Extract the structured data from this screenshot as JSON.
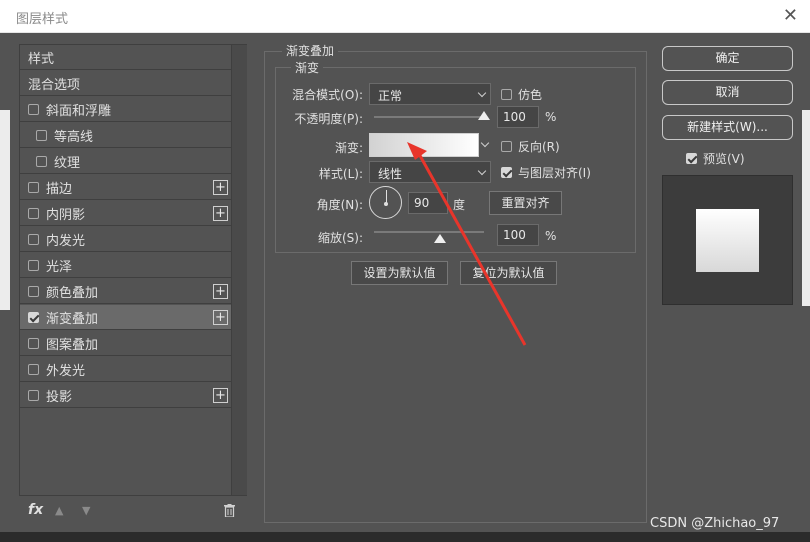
{
  "window": {
    "title": "图层样式",
    "close_symbol": "✕"
  },
  "style_list": {
    "items": [
      {
        "label": "样式",
        "checkbox": false,
        "checked": false,
        "plus": false,
        "indent": false,
        "selected": false
      },
      {
        "label": "混合选项",
        "checkbox": false,
        "checked": false,
        "plus": false,
        "indent": false,
        "selected": false
      },
      {
        "label": "斜面和浮雕",
        "checkbox": true,
        "checked": false,
        "plus": false,
        "indent": false,
        "selected": false
      },
      {
        "label": "等高线",
        "checkbox": true,
        "checked": false,
        "plus": false,
        "indent": true,
        "selected": false
      },
      {
        "label": "纹理",
        "checkbox": true,
        "checked": false,
        "plus": false,
        "indent": true,
        "selected": false
      },
      {
        "label": "描边",
        "checkbox": true,
        "checked": false,
        "plus": true,
        "indent": false,
        "selected": false
      },
      {
        "label": "内阴影",
        "checkbox": true,
        "checked": false,
        "plus": true,
        "indent": false,
        "selected": false
      },
      {
        "label": "内发光",
        "checkbox": true,
        "checked": false,
        "plus": false,
        "indent": false,
        "selected": false
      },
      {
        "label": "光泽",
        "checkbox": true,
        "checked": false,
        "plus": false,
        "indent": false,
        "selected": false
      },
      {
        "label": "颜色叠加",
        "checkbox": true,
        "checked": false,
        "plus": true,
        "indent": false,
        "selected": false
      },
      {
        "label": "渐变叠加",
        "checkbox": true,
        "checked": true,
        "plus": true,
        "indent": false,
        "selected": true
      },
      {
        "label": "图案叠加",
        "checkbox": true,
        "checked": false,
        "plus": false,
        "indent": false,
        "selected": false
      },
      {
        "label": "外发光",
        "checkbox": true,
        "checked": false,
        "plus": false,
        "indent": false,
        "selected": false
      },
      {
        "label": "投影",
        "checkbox": true,
        "checked": false,
        "plus": true,
        "indent": false,
        "selected": false
      }
    ],
    "footer": {
      "fx_label": "fx",
      "plus_symbol": "+"
    }
  },
  "panel": {
    "section_title": "渐变叠加",
    "subsection_title": "渐变",
    "blend_mode": {
      "label": "混合模式(O):",
      "value": "正常",
      "dither_label": "仿色",
      "dither_checked": false
    },
    "opacity": {
      "label": "不透明度(P):",
      "value": "100",
      "unit": "%",
      "level": 1.0
    },
    "gradient": {
      "label": "渐变:",
      "reverse_label": "反向(R)",
      "reverse_checked": false
    },
    "style": {
      "label": "样式(L):",
      "value": "线性",
      "align_label": "与图层对齐(I)",
      "align_checked": true
    },
    "angle": {
      "label": "角度(N):",
      "value": "90",
      "unit": "度",
      "reset_label": "重置对齐"
    },
    "scale": {
      "label": "缩放(S):",
      "value": "100",
      "unit": "%",
      "level": 0.6
    },
    "make_default_label": "设置为默认值",
    "reset_default_label": "复位为默认值"
  },
  "right": {
    "ok_label": "确定",
    "cancel_label": "取消",
    "new_style_label": "新建样式(W)...",
    "preview_label": "预览(V)",
    "preview_checked": true
  },
  "watermark": "CSDN @Zhichao_97",
  "colors": {
    "dialog_bg": "#535353",
    "selected_row": "#6a6a6a",
    "annotation_arrow": "#e8352b"
  }
}
